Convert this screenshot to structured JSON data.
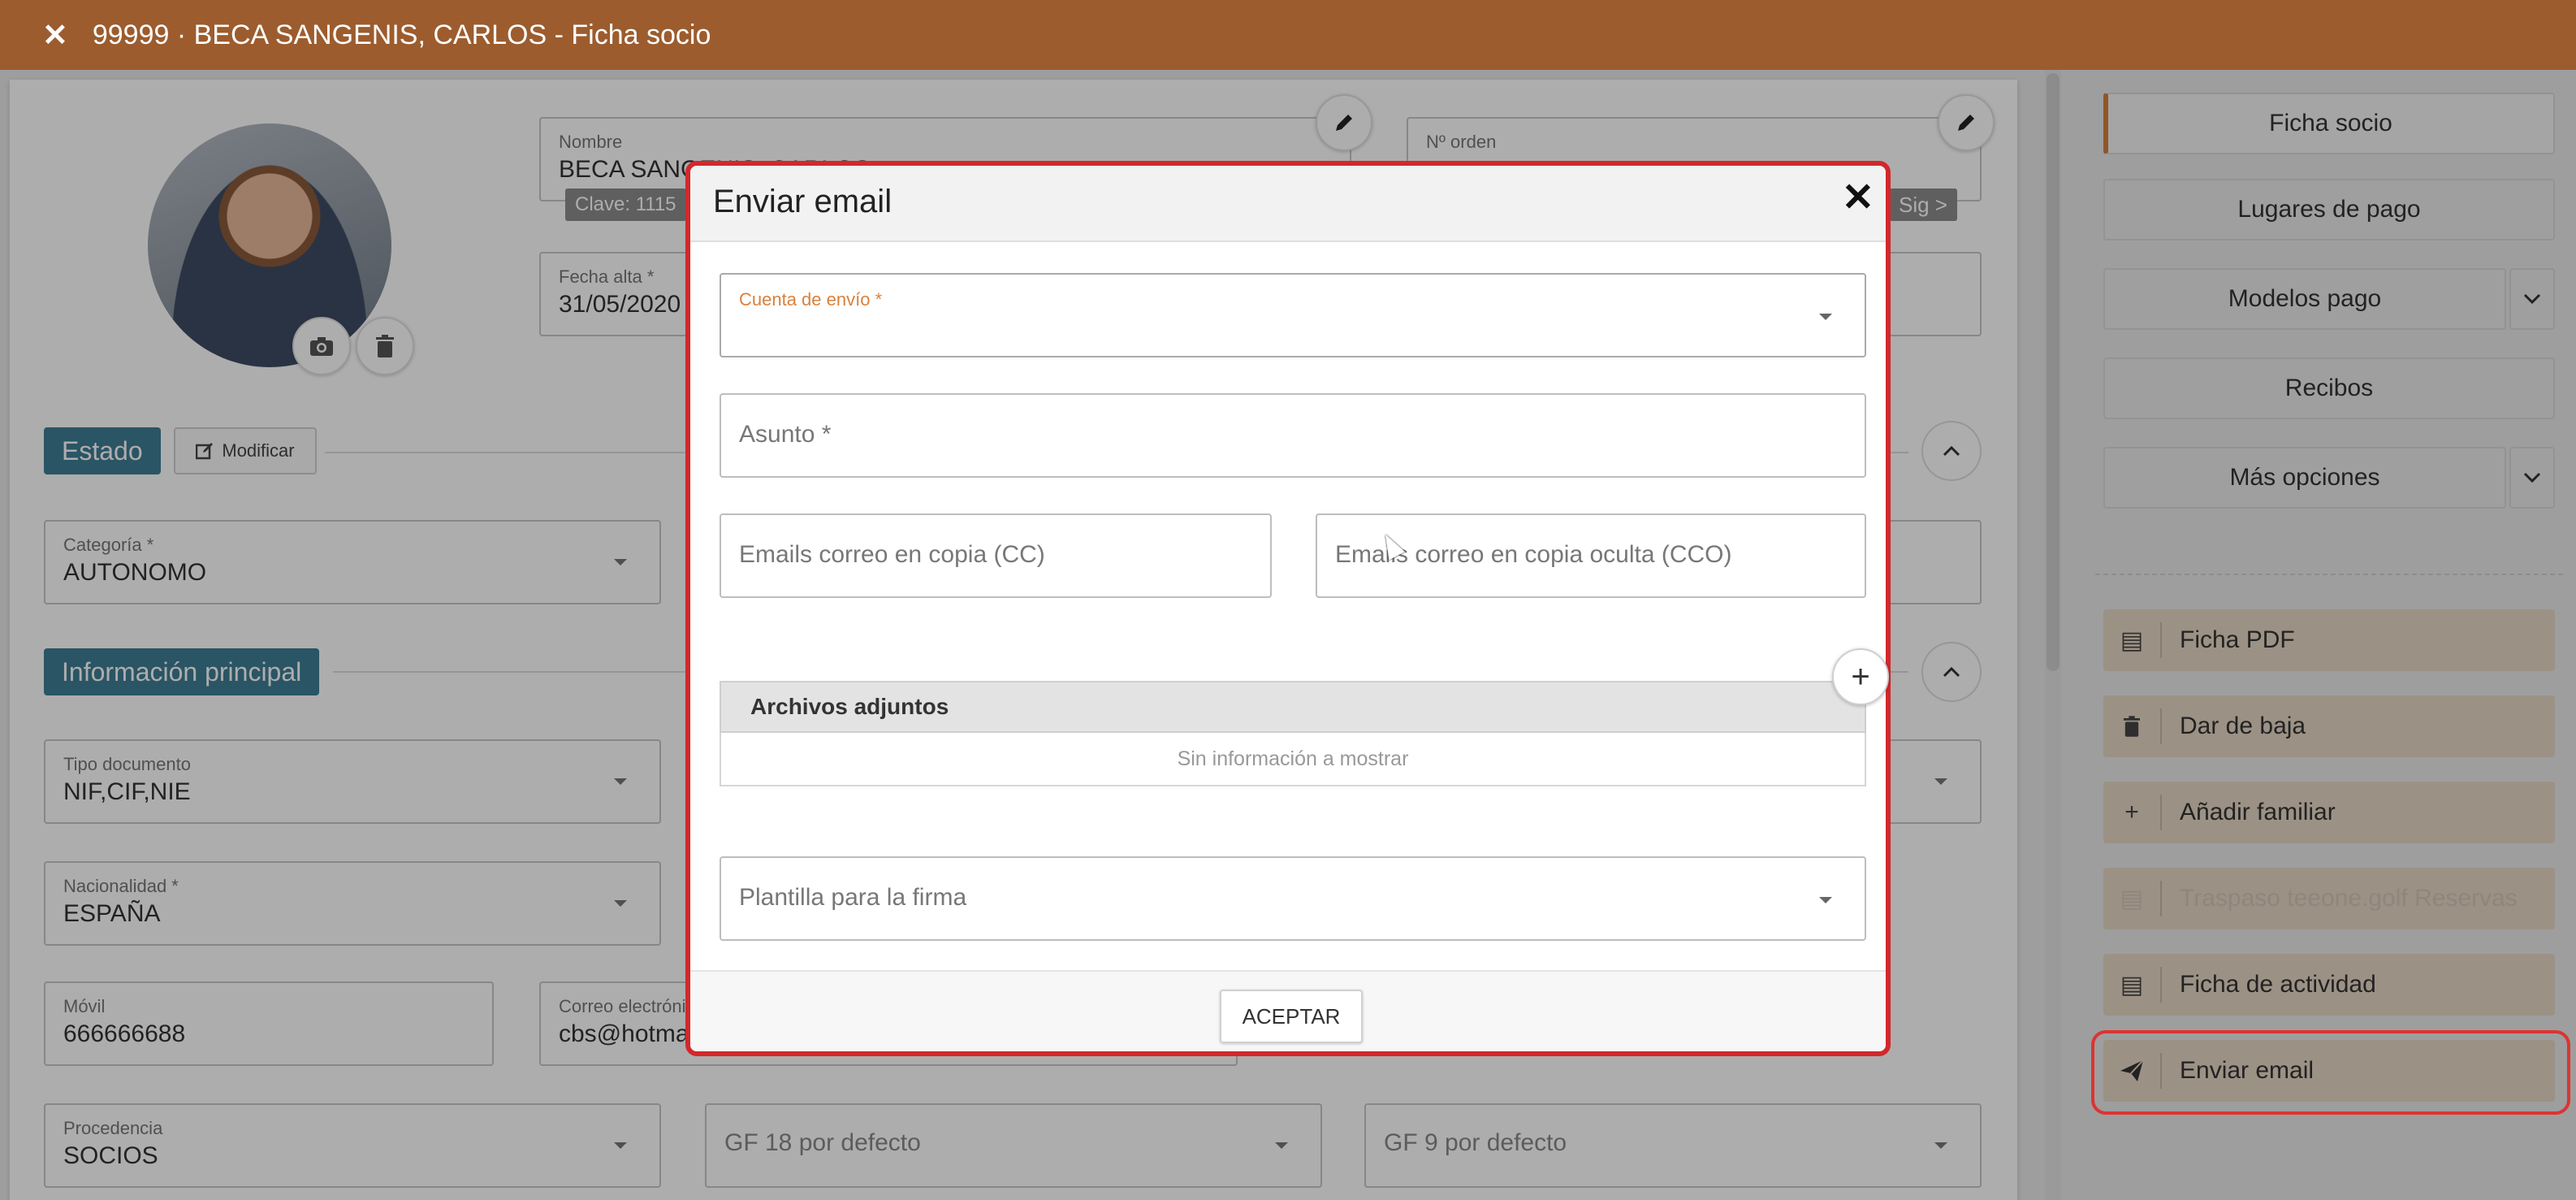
{
  "titlebar": {
    "close_icon": "close-icon",
    "title": "99999 · BECA SANGENIS, CARLOS - Ficha socio"
  },
  "form": {
    "nombre": {
      "label": "Nombre",
      "value": "BECA SANGENIS, CARLOS"
    },
    "clave": "Clave: 1115",
    "norden": {
      "label": "Nº orden"
    },
    "sig": "Sig >",
    "fecha_alta": {
      "label": "Fecha alta *",
      "value": "31/05/2020"
    },
    "estado_badge": "Estado",
    "modificar": "Modificar",
    "categoria": {
      "label": "Categoría *",
      "value": "AUTONOMO"
    },
    "info_badge": "Información principal",
    "tipo_documento": {
      "label": "Tipo documento",
      "value": "NIF,CIF,NIE"
    },
    "nacionalidad": {
      "label": "Nacionalidad *",
      "value": "ESPAÑA"
    },
    "movil": {
      "label": "Móvil",
      "value": "666666688"
    },
    "correo": {
      "label": "Correo electrónico",
      "value": "cbs@hotmail.com"
    },
    "procedencia": {
      "label": "Procedencia",
      "value": "SOCIOS"
    },
    "gf18": {
      "placeholder": "GF 18 por defecto"
    },
    "gf9": {
      "placeholder": "GF 9 por defecto"
    }
  },
  "right_panel": {
    "nav": [
      "Ficha socio",
      "Lugares de pago",
      "Modelos pago",
      "Recibos",
      "Más opciones"
    ],
    "actions": [
      {
        "label": "Ficha PDF",
        "icon": "document-icon"
      },
      {
        "label": "Dar de baja",
        "icon": "trash-icon"
      },
      {
        "label": "Añadir familiar",
        "icon": "plus-icon"
      },
      {
        "label": "Traspaso teeone.golf Reservas",
        "icon": "document-icon"
      },
      {
        "label": "Ficha de actividad",
        "icon": "document-icon"
      },
      {
        "label": "Enviar email",
        "icon": "send-icon"
      }
    ]
  },
  "modal": {
    "title": "Enviar email",
    "cuenta_label": "Cuenta de envío *",
    "asunto_placeholder": "Asunto *",
    "cc_placeholder": "Emails correo en copia (CC)",
    "cco_placeholder": "Emails correo en copia oculta (CCO)",
    "attachments_header": "Archivos adjuntos",
    "attachments_empty": "Sin información a mostrar",
    "firma_placeholder": "Plantilla para la firma",
    "accept_label": "ACEPTAR"
  },
  "colors": {
    "titlebar": "#9c5c2e",
    "accent": "#d67f3a",
    "section": "#3f7e96",
    "highlight": "#d3282b",
    "action_bg": "#e6d6c5"
  }
}
